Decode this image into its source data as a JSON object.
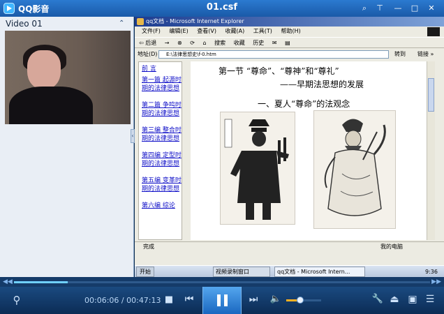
{
  "window": {
    "app_name": "QQ影音",
    "file_title": "01.csf",
    "buttons": {
      "skin": "⌕",
      "pin": "⊤",
      "minimize": "—",
      "maximize": "□",
      "close": "✕"
    }
  },
  "playlist": {
    "title": "Video 01",
    "collapse": "⌃",
    "splitter": "‹"
  },
  "video_content": {
    "ie_title": "qq文档 - Microsoft Internet Explorer",
    "ie_menu": [
      "文件(F)",
      "编辑(E)",
      "查看(V)",
      "收藏(A)",
      "工具(T)",
      "帮助(H)"
    ],
    "ie_toolbar": [
      "⇦ 后退",
      "→",
      "⊗",
      "⟳",
      "⌂",
      "搜索",
      "收藏",
      "历史",
      "✉",
      "▤"
    ],
    "address_label": "地址(D)",
    "address_value": "E:\\法律思想史\\f-0.htm",
    "go_label": "转到",
    "links_label": "链接 »",
    "nav_links": [
      "前 言",
      "第一篇 起源时期的法律思想",
      "第二篇 争鸣时期的法律思想",
      "第三编 整合时期的法律思想",
      "第四编 定型时期的法律思想",
      "第五编 变革时期的法律思想",
      "第六编 综论"
    ],
    "heading1": "第一节  “尊命”、“尊神”和“尊礼”",
    "heading2": "——早期法思想的发展",
    "heading3": "一、夏人“尊命”的法观念",
    "status_left": "完成",
    "status_right": "我的电脑",
    "taskbar_start": "开始",
    "taskbar_items": [
      "视频录制窗口",
      "qq文档 - Microsoft Intern..."
    ],
    "taskbar_clock": "9:36"
  },
  "seek": {
    "progress": 0.13,
    "prev": "◀◀",
    "next": "▶▶"
  },
  "controls": {
    "shortcut_icon": "⚲",
    "current_time": "00:06:06",
    "separator": " / ",
    "total_time": "00:47:13",
    "stop": "■",
    "prev": "⏮",
    "next": "⏭",
    "volume_icon": "🔈",
    "volume_level": 0.4,
    "tools": "🔧",
    "eject": "⏏",
    "screenshot": "▣",
    "playlist": "☰"
  },
  "colors": {
    "accent": "#2b7ad0",
    "seek_fill": "#6fd0ff",
    "volume_fill": "#ffb020"
  }
}
